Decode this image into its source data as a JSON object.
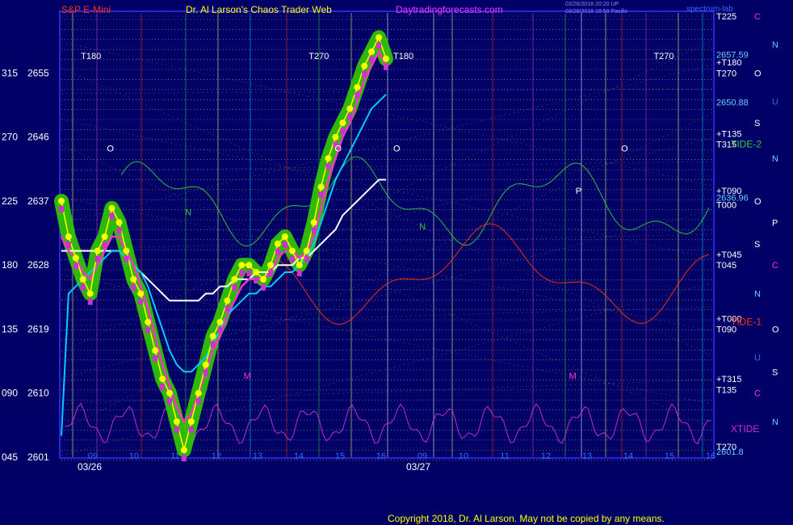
{
  "header": {
    "instrument": "S&P E-Mini",
    "site": "Dr. Al Larson's Chaos Trader Web",
    "url": "Daytradingforecasts.com",
    "stamp1": "03/26/2018 20:20 UP",
    "stamp2": "03/26/2018 19:59 Pacific",
    "brand": "spectrum-lab"
  },
  "footer": {
    "copyright": "Copyright 2018, Dr. Al Larson. May not be copied by any means."
  },
  "colors": {
    "background": "#000066",
    "price": "#ffff00",
    "price_glow": "#33cc00",
    "short_ma": "#ff33cc",
    "mid_ma": "#00ccff",
    "long_ma": "#ffffff",
    "grid_yellow": "#ffff66",
    "red_flux": "#ff3300",
    "green_flux": "#33cc33",
    "xtide": "#cc33cc"
  },
  "chart_data": {
    "type": "line",
    "x_tick_labels": [
      "09",
      "10",
      "11",
      "12",
      "13",
      "14",
      "15",
      "16",
      "09",
      "10",
      "11",
      "12",
      "13",
      "14",
      "15",
      "16"
    ],
    "date_labels": [
      "03/26",
      "03/27"
    ],
    "y_ticks": [
      {
        "angle": "315",
        "price": 2655
      },
      {
        "angle": "270",
        "price": 2646
      },
      {
        "angle": "225",
        "price": 2637
      },
      {
        "angle": "180",
        "price": 2628
      },
      {
        "angle": "135",
        "price": 2619
      },
      {
        "angle": "090",
        "price": 2610
      },
      {
        "angle": "045",
        "price": 2601
      }
    ],
    "ylim": [
      2601,
      2663
    ],
    "series": [
      {
        "key": "price",
        "values": [
          2637,
          2632,
          2629,
          2626,
          2624,
          2630,
          2632,
          2636,
          2634,
          2630,
          2626,
          2624,
          2620,
          2616,
          2612,
          2610,
          2606,
          2602,
          2606,
          2610,
          2614,
          2618,
          2620,
          2623,
          2626,
          2628,
          2628,
          2627,
          2626,
          2628,
          2631,
          2632,
          2630,
          2628,
          2630,
          2634,
          2639,
          2643,
          2646,
          2648,
          2650,
          2653,
          2656,
          2658,
          2660,
          2657
        ]
      },
      {
        "key": "short_ma",
        "values": [
          2632,
          2630,
          2629,
          2627,
          2626,
          2628,
          2630,
          2632,
          2632,
          2630,
          2628,
          2625,
          2622,
          2618,
          2614,
          2611,
          2608,
          2606,
          2607,
          2610,
          2613,
          2616,
          2618,
          2621,
          2623,
          2625,
          2626,
          2626,
          2626,
          2627,
          2629,
          2630,
          2630,
          2629,
          2630,
          2632,
          2636,
          2640,
          2643,
          2646,
          2648,
          2651,
          2654,
          2656,
          2658,
          2656
        ]
      },
      {
        "key": "mid_ma",
        "values": [
          2604,
          2624,
          2625,
          2626,
          2627,
          2628,
          2629,
          2630,
          2630,
          2629,
          2628,
          2627,
          2625,
          2622,
          2619,
          2616,
          2614,
          2613,
          2613,
          2614,
          2615,
          2617,
          2619,
          2621,
          2622,
          2623,
          2624,
          2624,
          2625,
          2625,
          2626,
          2627,
          2627,
          2628,
          2629,
          2631,
          2634,
          2637,
          2640,
          2642,
          2644,
          2646,
          2648,
          2650,
          2651,
          2652
        ]
      },
      {
        "key": "long_ma",
        "values": [
          2630,
          2630,
          2630,
          2630,
          2630,
          2630,
          2630,
          2630,
          2630,
          2629,
          2628,
          2627,
          2626,
          2625,
          2624,
          2623,
          2623,
          2623,
          2623,
          2623,
          2624,
          2624,
          2625,
          2625,
          2626,
          2626,
          2626,
          2627,
          2627,
          2627,
          2628,
          2628,
          2628,
          2629,
          2629,
          2630,
          2631,
          2632,
          2633,
          2635,
          2636,
          2637,
          2638,
          2639,
          2640,
          2640
        ]
      }
    ],
    "right_levels": [
      {
        "label": "T225",
        "price": 2663
      },
      {
        "label": "2657.59",
        "price": 2657.59
      },
      {
        "label": "+T180",
        "price": 2656.5
      },
      {
        "label": "T270",
        "price": 2655
      },
      {
        "label": "2650.88",
        "price": 2650.88
      },
      {
        "label": "+T135",
        "price": 2646.5
      },
      {
        "label": "T315",
        "price": 2645
      },
      {
        "label": "+T090",
        "price": 2638.5
      },
      {
        "label": "2636.96",
        "price": 2637.5
      },
      {
        "label": "T000",
        "price": 2636.5
      },
      {
        "label": "+T045",
        "price": 2629.5
      },
      {
        "label": "T045",
        "price": 2628
      },
      {
        "label": "+T000",
        "price": 2620.5
      },
      {
        "label": "T090",
        "price": 2619
      },
      {
        "label": "+T315",
        "price": 2612
      },
      {
        "label": "T135",
        "price": 2610.5
      },
      {
        "label": "T270",
        "price": 2602.5
      },
      {
        "label": "2601.8",
        "price": 2601.8
      }
    ],
    "right_side_labels": [
      {
        "text": "TIDE-2",
        "price": 2645
      },
      {
        "text": "TIDE-1",
        "price": 2620
      },
      {
        "text": "XTIDE",
        "price": 2605
      }
    ],
    "planet_column_1": [
      {
        "text": "C",
        "price": 2663
      },
      {
        "text": "N",
        "price": 2659
      },
      {
        "text": "O",
        "price": 2655
      },
      {
        "text": "U",
        "price": 2651
      },
      {
        "text": "S",
        "price": 2648
      },
      {
        "text": "N",
        "price": 2643
      },
      {
        "text": "O",
        "price": 2637
      },
      {
        "text": "P",
        "price": 2634
      },
      {
        "text": "S",
        "price": 2631
      },
      {
        "text": "C",
        "price": 2628
      },
      {
        "text": "N",
        "price": 2624
      },
      {
        "text": "O",
        "price": 2619
      },
      {
        "text": "U",
        "price": 2615
      },
      {
        "text": "S",
        "price": 2613
      },
      {
        "text": "C",
        "price": 2610
      },
      {
        "text": "N",
        "price": 2606
      }
    ],
    "chart_annotations": [
      {
        "text": "T180",
        "x": 3,
        "price": 2657
      },
      {
        "text": "T270",
        "x": 38,
        "price": 2657
      },
      {
        "text": "T180",
        "x": 51,
        "price": 2657
      },
      {
        "text": "T270",
        "x": 91,
        "price": 2657
      },
      {
        "text": "O",
        "x": 7,
        "price": 2644
      },
      {
        "text": "O",
        "x": 42,
        "price": 2644
      },
      {
        "text": "O",
        "x": 51,
        "price": 2644
      },
      {
        "text": "O",
        "x": 86,
        "price": 2644
      },
      {
        "text": "N",
        "x": 19,
        "price": 2635
      },
      {
        "text": "N",
        "x": 55,
        "price": 2633
      },
      {
        "text": "M",
        "x": 28,
        "price": 2612
      },
      {
        "text": "M",
        "x": 78,
        "price": 2612
      },
      {
        "text": "P",
        "x": 79,
        "price": 2638
      }
    ]
  }
}
